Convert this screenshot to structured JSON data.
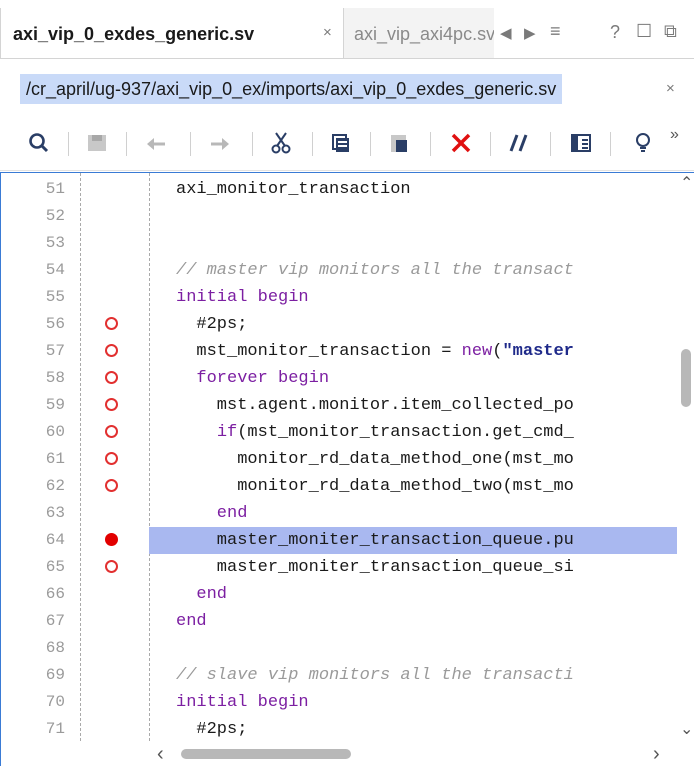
{
  "tabs": {
    "active_label": "axi_vip_0_exdes_generic.sv",
    "inactive_label": "axi_vip_axi4pc.sv",
    "close_glyph": "×",
    "prev_glyph": "◀",
    "next_glyph": "▶",
    "menu_glyph": "≡",
    "help_glyph": "?",
    "restore_glyph": "☐",
    "float_glyph": "⧉"
  },
  "path": {
    "text": "/cr_april/ug-937/axi_vip_0_ex/imports/axi_vip_0_exdes_generic.sv",
    "close_glyph": "×"
  },
  "toolbar": {
    "icons": [
      "search-icon",
      "save-icon",
      "undo-icon",
      "redo-icon",
      "cut-icon",
      "copy-icon",
      "paste-icon",
      "delete-icon",
      "comment-icon",
      "columns-icon",
      "lightbulb-icon"
    ],
    "overflow": "»"
  },
  "editor": {
    "lines": [
      {
        "n": "51",
        "bp": "",
        "tokens": [
          {
            "t": "axi_monitor_transaction",
            "c": ""
          }
        ]
      },
      {
        "n": "52",
        "bp": "",
        "tokens": []
      },
      {
        "n": "53",
        "bp": "",
        "tokens": []
      },
      {
        "n": "54",
        "bp": "",
        "tokens": [
          {
            "t": "// master vip monitors all the transact",
            "c": "cm"
          }
        ]
      },
      {
        "n": "55",
        "bp": "",
        "tokens": [
          {
            "t": "initial begin",
            "c": "kw"
          }
        ]
      },
      {
        "n": "56",
        "bp": "enabled",
        "tokens": [
          {
            "t": "  #2ps;",
            "c": ""
          }
        ]
      },
      {
        "n": "57",
        "bp": "enabled",
        "tokens": [
          {
            "t": "  mst_monitor_transaction = ",
            "c": ""
          },
          {
            "t": "new",
            "c": "kw"
          },
          {
            "t": "(",
            "c": ""
          },
          {
            "t": "\"master",
            "c": "str"
          }
        ]
      },
      {
        "n": "58",
        "bp": "enabled",
        "tokens": [
          {
            "t": "  forever begin",
            "c": "kw"
          }
        ]
      },
      {
        "n": "59",
        "bp": "enabled",
        "tokens": [
          {
            "t": "    mst.agent.monitor.item_collected_po",
            "c": ""
          }
        ]
      },
      {
        "n": "60",
        "bp": "enabled",
        "tokens": [
          {
            "t": "    ",
            "c": ""
          },
          {
            "t": "if",
            "c": "kw"
          },
          {
            "t": "(mst_monitor_transaction.get_cmd_",
            "c": ""
          }
        ]
      },
      {
        "n": "61",
        "bp": "enabled",
        "tokens": [
          {
            "t": "      monitor_rd_data_method_one(mst_mo",
            "c": ""
          }
        ]
      },
      {
        "n": "62",
        "bp": "enabled",
        "tokens": [
          {
            "t": "      monitor_rd_data_method_two(mst_mo",
            "c": ""
          }
        ]
      },
      {
        "n": "63",
        "bp": "",
        "tokens": [
          {
            "t": "    end",
            "c": "kw"
          }
        ]
      },
      {
        "n": "64",
        "bp": "hit",
        "hl": true,
        "tokens": [
          {
            "t": "    master_moniter_transaction_queue.pu",
            "c": ""
          }
        ]
      },
      {
        "n": "65",
        "bp": "enabled",
        "tokens": [
          {
            "t": "    master_moniter_transaction_queue_si",
            "c": ""
          }
        ]
      },
      {
        "n": "66",
        "bp": "",
        "tokens": [
          {
            "t": "  end",
            "c": "kw"
          }
        ]
      },
      {
        "n": "67",
        "bp": "",
        "tokens": [
          {
            "t": "end",
            "c": "kw"
          }
        ]
      },
      {
        "n": "68",
        "bp": "",
        "tokens": []
      },
      {
        "n": "69",
        "bp": "",
        "tokens": [
          {
            "t": "// slave vip monitors all the transacti",
            "c": "cm"
          }
        ]
      },
      {
        "n": "70",
        "bp": "",
        "tokens": [
          {
            "t": "initial begin",
            "c": "kw"
          }
        ]
      },
      {
        "n": "71",
        "bp": "",
        "tokens": [
          {
            "t": "  #2ps;",
            "c": ""
          }
        ]
      }
    ]
  },
  "scroll": {
    "up": "⌃",
    "down": "⌄",
    "left": "‹",
    "right": "›"
  }
}
